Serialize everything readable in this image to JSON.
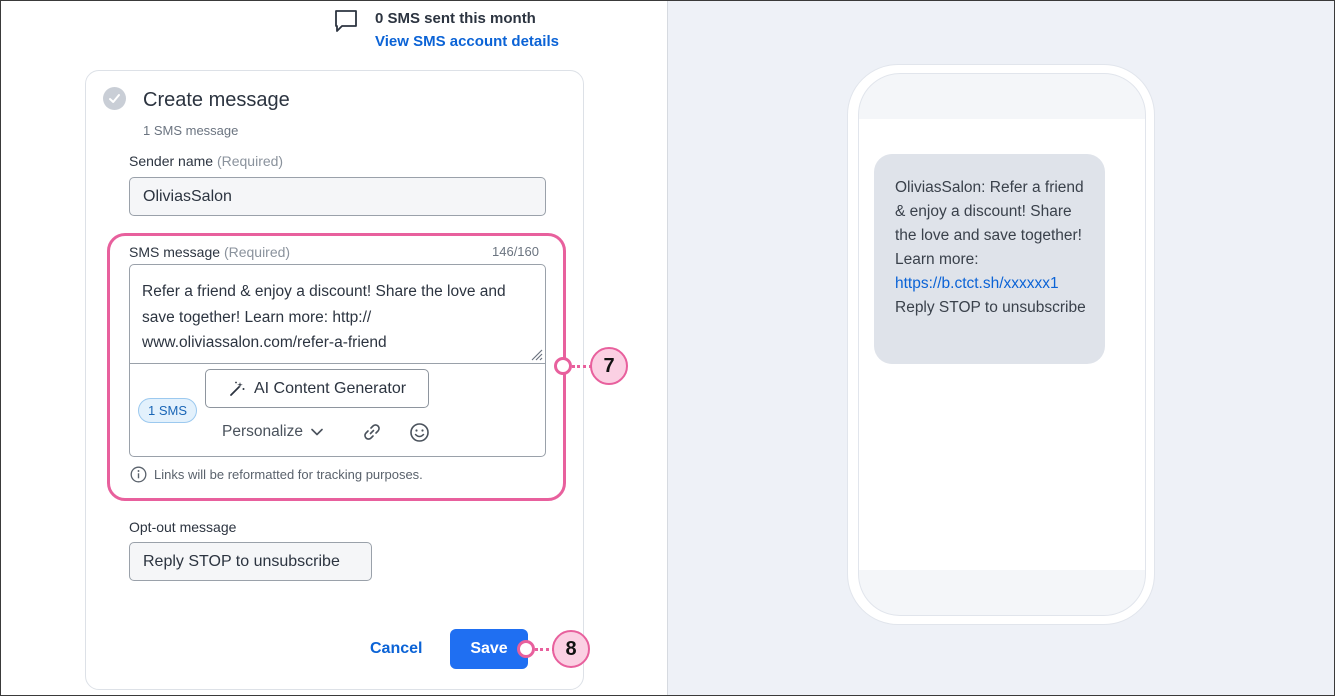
{
  "sms_status": {
    "count_text": "0 SMS sent this month",
    "account_link": "View SMS account details"
  },
  "card": {
    "title": "Create message",
    "subtitle": "1 SMS message"
  },
  "sender": {
    "label": "Sender name",
    "required": "(Required)",
    "value": "OliviasSalon"
  },
  "sms_message": {
    "label": "SMS message",
    "required": "(Required)",
    "counter": "146/160",
    "text": "Refer a friend & enjoy a discount! Share the love and save together! Learn more: http:// www.oliviassalon.com/refer-a-friend",
    "segments_pill": "1 SMS",
    "ai_button": "AI Content Generator",
    "personalize": "Personalize",
    "note": "Links will be reformatted for tracking purposes."
  },
  "opt_out": {
    "label": "Opt-out message",
    "value": "Reply STOP to unsubscribe"
  },
  "actions": {
    "cancel": "Cancel",
    "save": "Save"
  },
  "callouts": {
    "seven": "7",
    "eight": "8"
  },
  "preview": {
    "line_prefix": "OliviasSalon: Refer a friend & enjoy a discount! Share the love and save together! Learn more:",
    "link": "https://b.ctct.sh/xxxxxx1",
    "line_suffix": "Reply STOP to unsubscribe"
  },
  "colors": {
    "accent_blue": "#1f6ff2",
    "link_blue": "#0b63d6",
    "callout_pink": "#e8609d",
    "callout_fill": "#fbd0e3",
    "preview_bg": "#eef1f7",
    "bubble_bg": "#dfe3ea"
  },
  "icons": {
    "sms": "chat-bubble-icon",
    "check": "check-icon",
    "ai": "magic-wand-icon",
    "chevron": "chevron-down-icon",
    "link": "link-icon",
    "emoji": "smiley-icon",
    "info": "info-icon",
    "resize": "resize-handle-icon"
  }
}
